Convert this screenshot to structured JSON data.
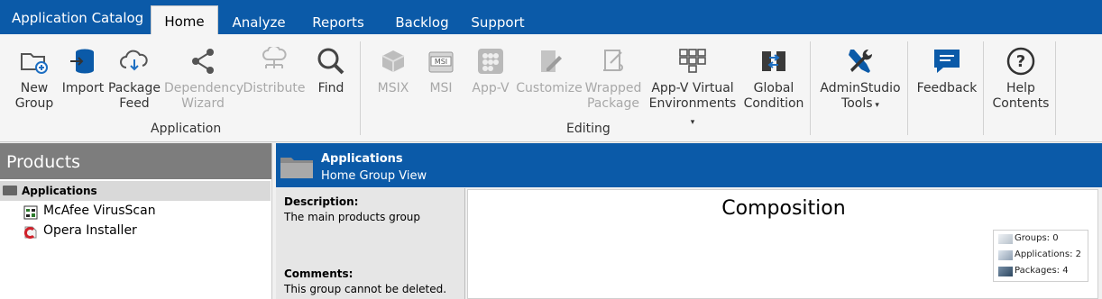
{
  "tabs": {
    "app": "Application Catalog",
    "items": [
      "Home",
      "Analyze",
      "Reports",
      "Backlog",
      "Support"
    ]
  },
  "ribbon": {
    "application_group_label": "Application",
    "editing_group_label": "Editing",
    "buttons": {
      "new_group": "New Group",
      "import": "Import",
      "package_feed": "Package Feed",
      "dependency_wizard": "Dependency Wizard",
      "distribute": "Distribute",
      "find": "Find",
      "msix": "MSIX",
      "msi": "MSI",
      "appv": "App-V",
      "customize": "Customize",
      "wrapped_package": "Wrapped Package",
      "appv_virtual": "App-V Virtual Environments",
      "global_condition": "Global Condition",
      "adminstudio_tools": "AdminStudio Tools",
      "feedback": "Feedback",
      "help_contents": "Help Contents"
    }
  },
  "products": {
    "header": "Products",
    "root": "Applications",
    "items": [
      "McAfee VirusScan",
      "Opera Installer"
    ]
  },
  "detail": {
    "title": "Applications",
    "subtitle": "Home Group View",
    "description_label": "Description:",
    "description": "The main products group",
    "comments_label": "Comments:",
    "comments": "This group cannot be deleted.",
    "composition_title": "Composition",
    "legend": [
      "Groups: 0",
      "Applications: 2",
      "Packages: 4"
    ]
  },
  "colors": {
    "brand_blue": "#0b5aa8"
  }
}
